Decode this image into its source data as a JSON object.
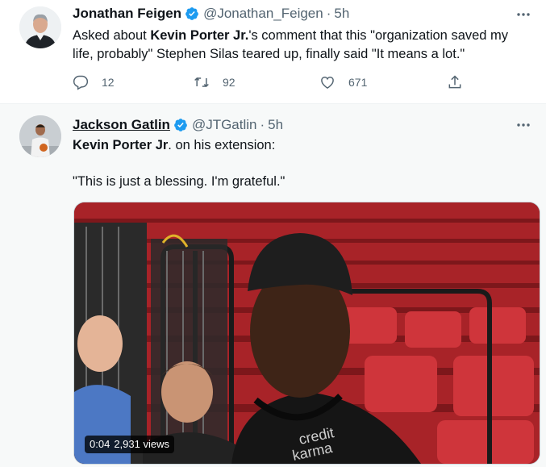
{
  "tweets": [
    {
      "author_name": "Jonathan Feigen",
      "handle": "@Jonathan_Feigen",
      "separator": "·",
      "time": "5h",
      "text_parts": [
        "Asked about ",
        "Kevin Porter Jr.",
        "'s comment that this \"organization saved my life, probably\" Stephen Silas teared up, finally said \"It means a lot.\""
      ],
      "actions": {
        "reply_count": "12",
        "retweet_count": "92",
        "like_count": "671"
      }
    },
    {
      "author_name": "Jackson Gatlin",
      "handle": "@JTGatlin",
      "separator": "·",
      "time": "5h",
      "text_line1_parts": [
        "Kevin Porter Jr",
        ". on his extension:"
      ],
      "text_line2": "\"This is just a blessing. I'm grateful.\"",
      "video": {
        "elapsed": "0:04",
        "views": "2,931 views"
      }
    }
  ],
  "colors": {
    "verified_badge": "#1d9bf0",
    "secondary_text": "#536471",
    "arena_seats": "#c0272d"
  },
  "icons": [
    "verified-badge-icon",
    "more-options-icon",
    "reply-icon",
    "retweet-icon",
    "like-icon",
    "share-icon"
  ]
}
